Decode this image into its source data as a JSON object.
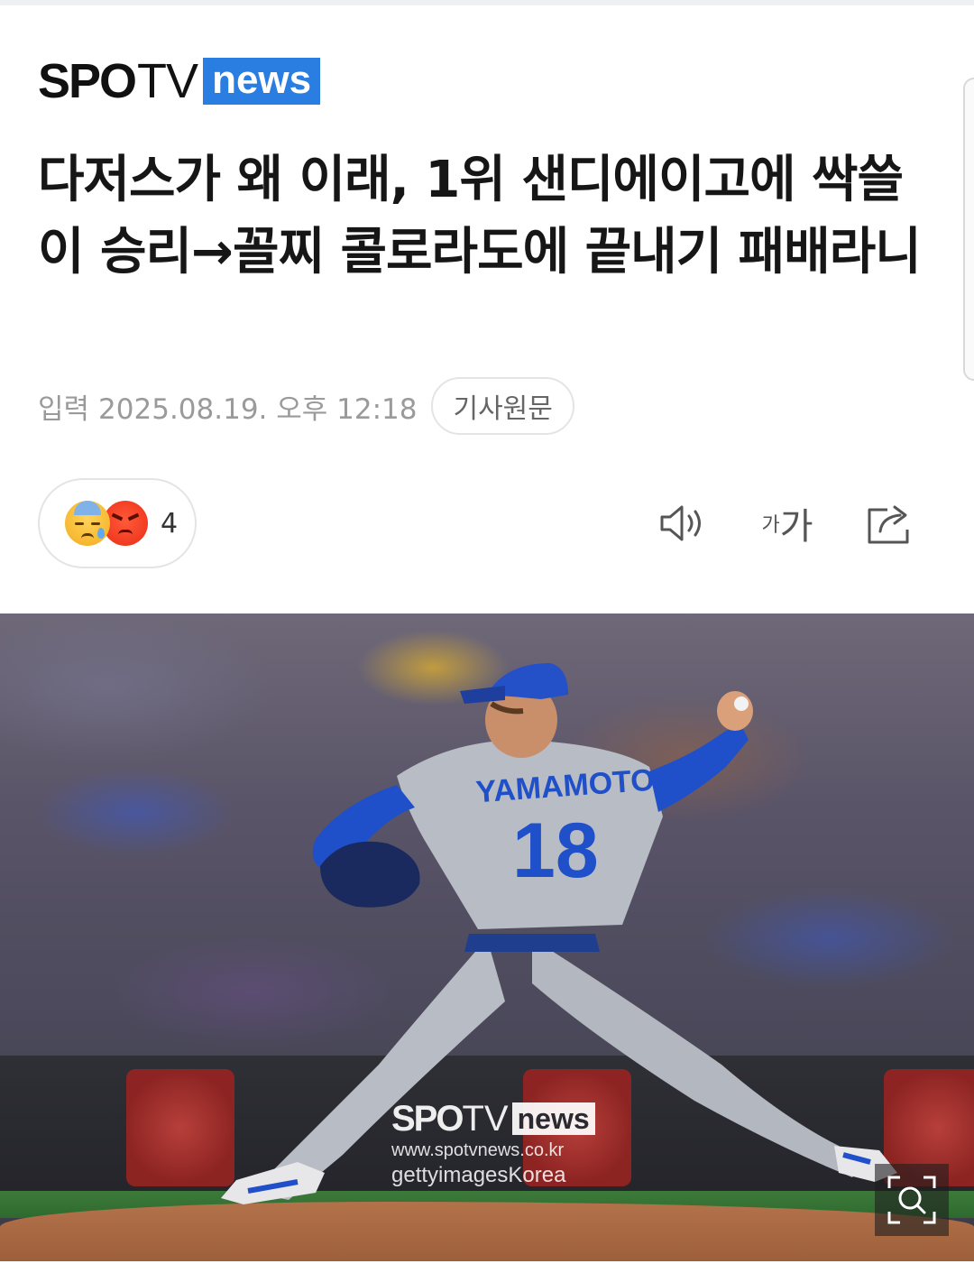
{
  "brand": {
    "logo_spo": "SPO",
    "logo_tv": "TV",
    "logo_news": "news"
  },
  "article": {
    "headline": "다저스가 왜 이래, 1위 샌디에이고에 싹쓸이 승리→꼴찌 콜로라도에 끝내기 패배라니",
    "date_label": "입력",
    "date_value": "2025.08.19. 오후 12:18",
    "original_button": "기사원문"
  },
  "reactions": {
    "emojis": [
      "sad-tear-emoji",
      "angry-emoji"
    ],
    "count": "4"
  },
  "toolbar": {
    "font_small": "가",
    "font_big": "가",
    "icons": [
      "speaker-icon",
      "font-size-icon",
      "share-icon"
    ]
  },
  "photo": {
    "jersey_name": "YAMAMOTO",
    "jersey_number": "18",
    "watermark_spo": "SPO",
    "watermark_tv": "TV",
    "watermark_news": "news",
    "watermark_url": "www.spotvnews.co.kr",
    "watermark_getty": "gettyimagesKorea"
  },
  "colors": {
    "brand_blue": "#2a7de1",
    "meta_gray": "#9a9a9a",
    "jersey_gray": "#b8bcc4",
    "dodger_blue": "#1f4fc9"
  }
}
